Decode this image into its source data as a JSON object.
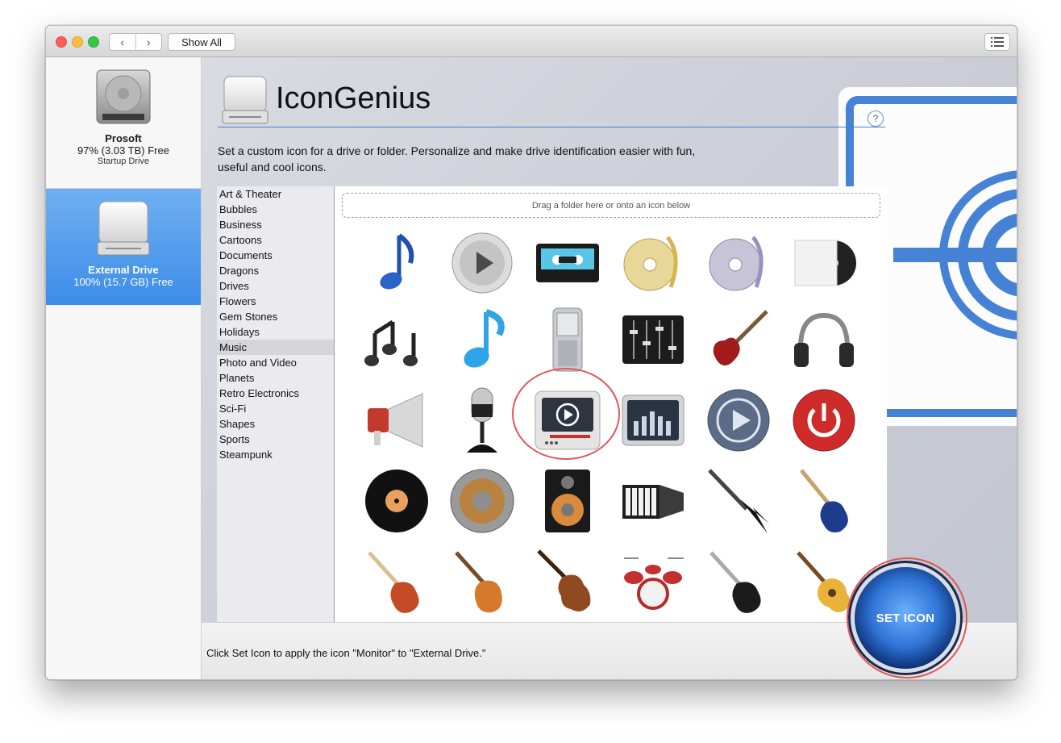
{
  "toolbar": {
    "back": "‹",
    "forward": "›",
    "show_all": "Show All"
  },
  "sidebar": {
    "drives": [
      {
        "name": "Prosoft",
        "free": "97% (3.03 TB) Free",
        "sub": "Startup Drive"
      },
      {
        "name": "External Drive",
        "free": "100% (15.7 GB) Free",
        "sub": ""
      }
    ]
  },
  "main": {
    "title": "IconGenius",
    "help": "?",
    "description": "Set a custom icon for a drive or folder. Personalize and make drive identification easier with fun, useful and cool icons.",
    "categories": [
      "Art & Theater",
      "Bubbles",
      "Business",
      "Cartoons",
      "Documents",
      "Dragons",
      "Drives",
      "Flowers",
      "Gem Stones",
      "Holidays",
      "Music",
      "Photo and Video",
      "Planets",
      "Retro Electronics",
      "Sci-Fi",
      "Shapes",
      "Sports",
      "Steampunk"
    ],
    "selected_category": "Music",
    "drop_hint": "Drag a folder here or onto an icon below",
    "icons": [
      [
        "music-note-icon",
        "play-disc-icon",
        "cassette-icon",
        "gold-cd-note-icon",
        "cd-note-icon",
        "vinyl-sleeve-icon"
      ],
      [
        "music-notes-icon",
        "blue-note-icon",
        "mp3-phone-icon",
        "mixer-icon",
        "electric-guitar-red-icon",
        "headphones-icon"
      ],
      [
        "megaphone-icon",
        "microphone-icon",
        "monitor-icon",
        "equalizer-icon",
        "play-button-icon",
        "power-button-icon"
      ],
      [
        "vinyl-record-icon",
        "speaker-round-icon",
        "speaker-box-icon",
        "accordion-icon",
        "flying-v-guitar-icon",
        "blue-guitar-icon"
      ],
      [
        "guitar-sunburst-icon",
        "les-paul-guitar-icon",
        "violin-icon",
        "drum-kit-icon",
        "black-guitar-icon",
        "acoustic-guitar-icon"
      ]
    ],
    "selected_icon": "monitor-icon"
  },
  "footer": {
    "status": "Click Set Icon to apply the icon \"Monitor\" to \"External Drive.\"",
    "set_icon": "SET ICON"
  },
  "colors": {
    "accent": "#3c8ce8",
    "highlight": "#e2565a",
    "title_rule": "#3f7fd6"
  }
}
